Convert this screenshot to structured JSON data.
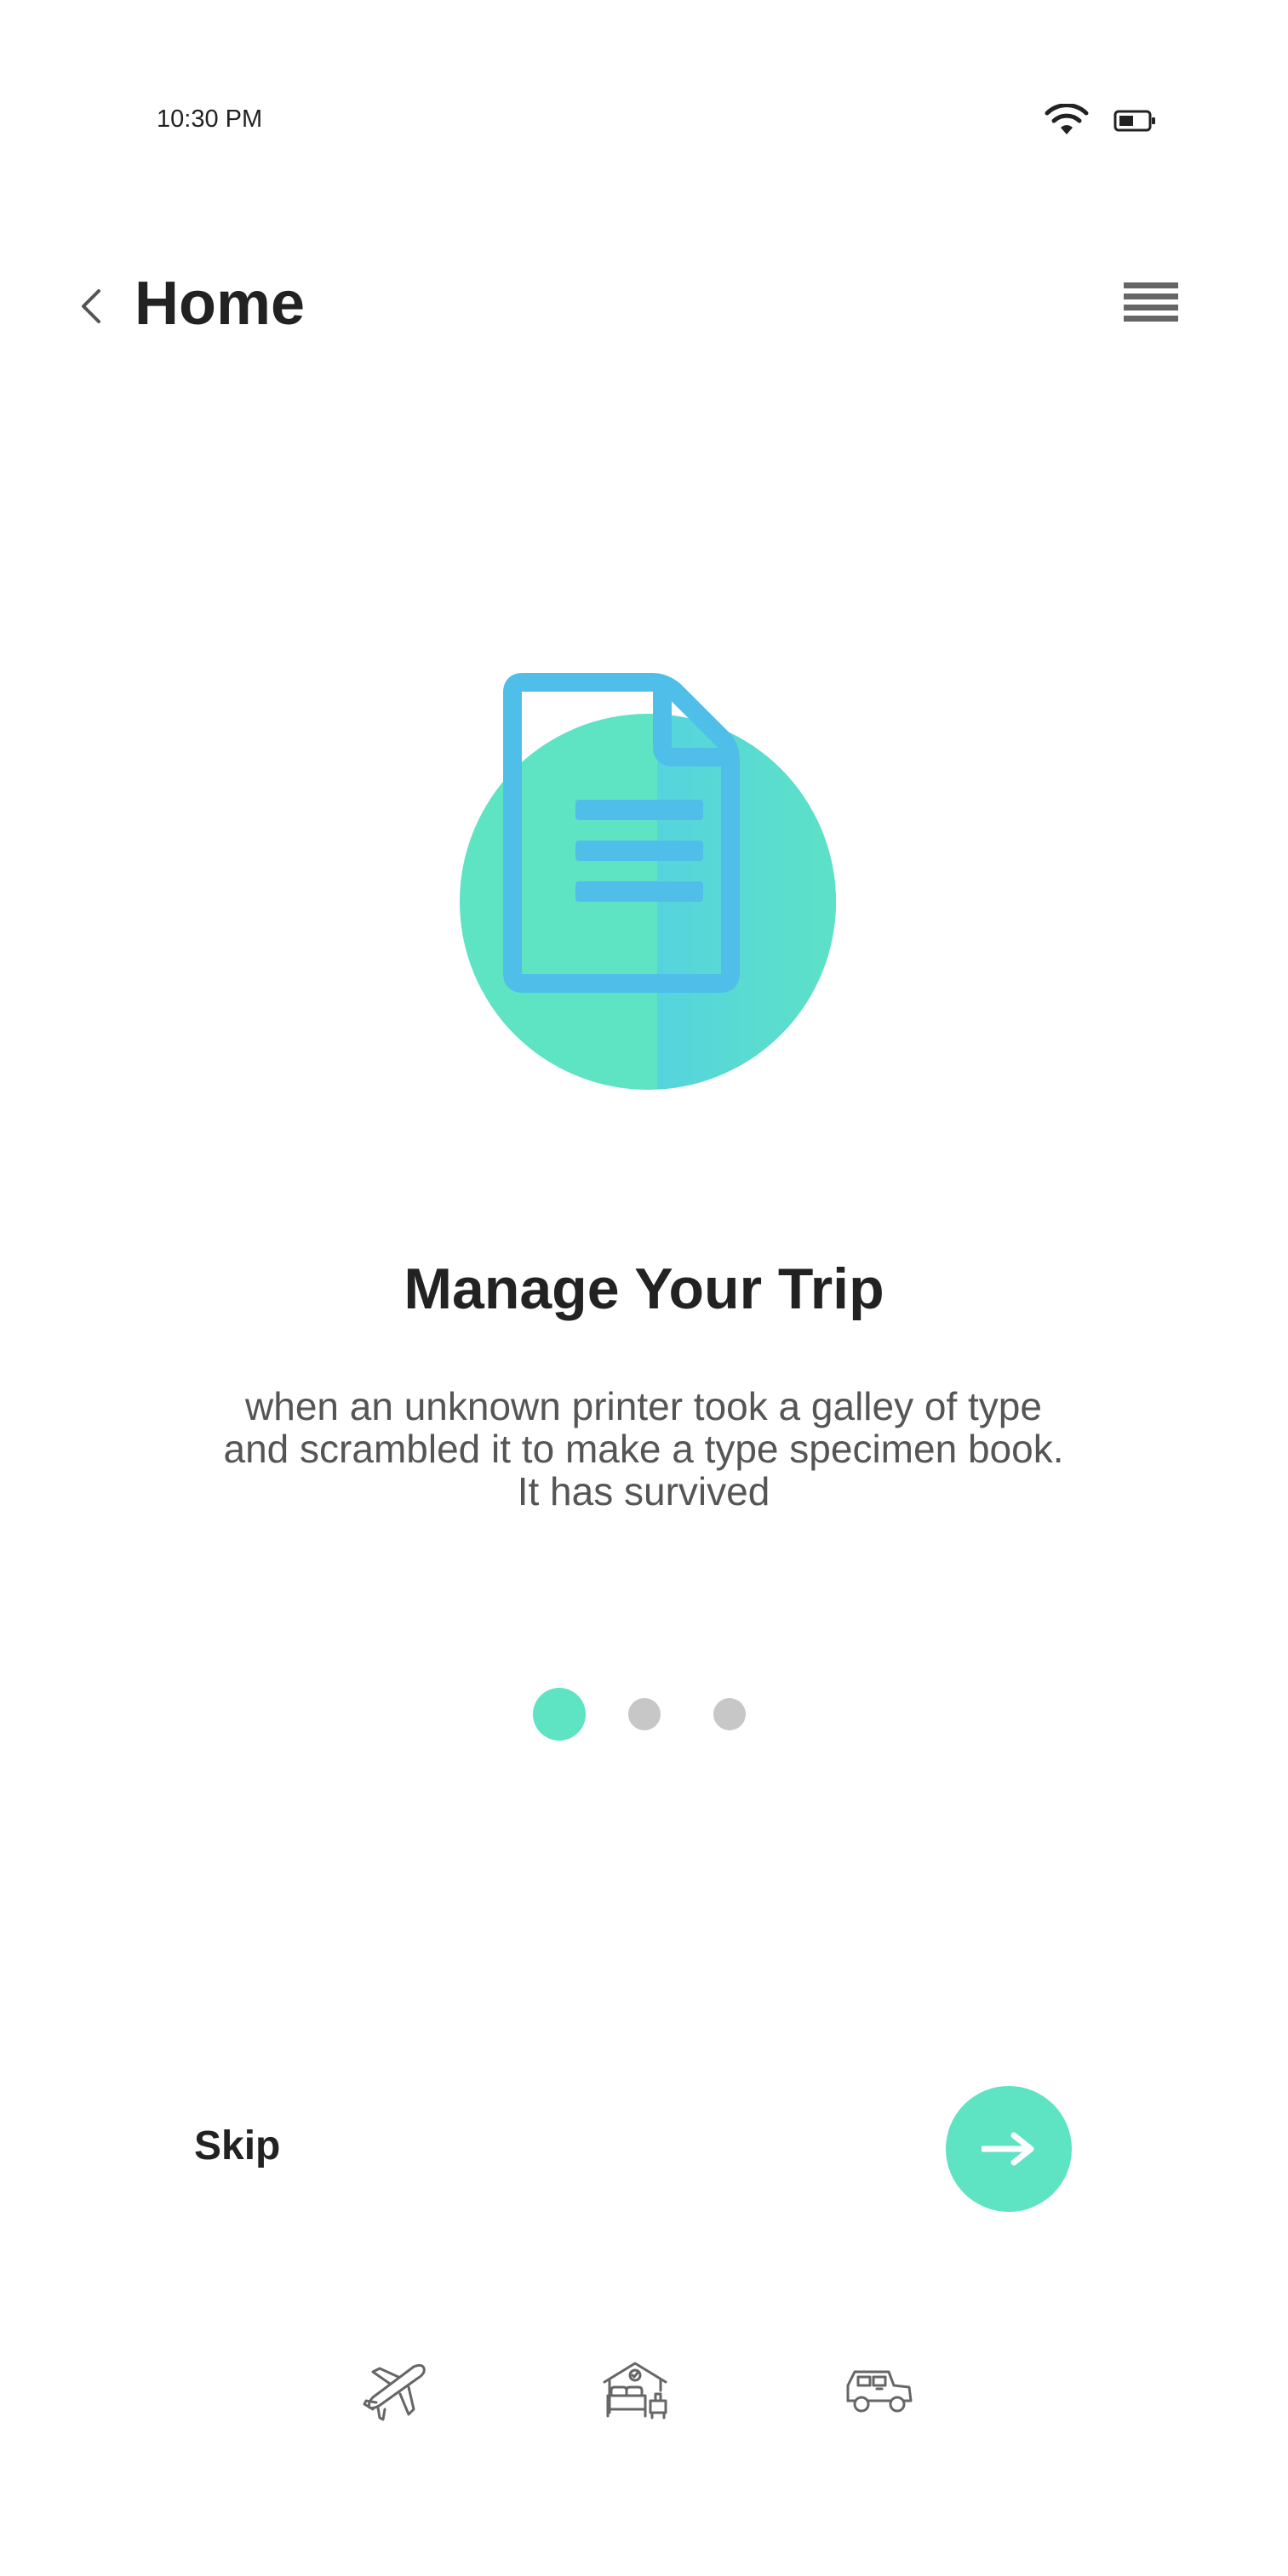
{
  "status_bar": {
    "time": "10:30 PM",
    "wifi_icon": "wifi-icon",
    "battery_icon": "battery-icon"
  },
  "header": {
    "title": "Home",
    "back_icon": "chevron-left-icon",
    "menu_icon": "menu-icon"
  },
  "slide": {
    "illustration_icon": "document-icon",
    "title": "Manage Your Trip",
    "description": "when an unknown printer took a galley of type and scrambled it to make a type specimen book. It has survived",
    "page_count": 3,
    "active_page": 1
  },
  "actions": {
    "skip_label": "Skip",
    "next_icon": "arrow-right-icon"
  },
  "bottom_icons": [
    "plane-icon",
    "hotel-icon",
    "car-icon"
  ],
  "colors": {
    "accent": "#5EE3C3",
    "document_blue": "#4FBFEA",
    "inactive_dot": "#C7C7C7",
    "text_dark": "#222222",
    "text_muted": "#555555"
  }
}
